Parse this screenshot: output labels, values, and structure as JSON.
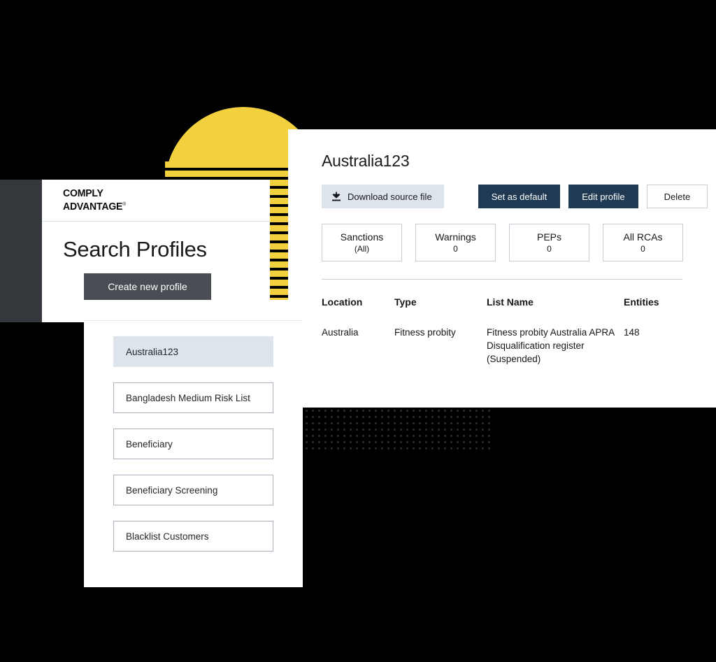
{
  "brand": {
    "name_line1": "COMPLY",
    "name_line2": "ADVANTAGE",
    "registered_mark": "®"
  },
  "search_panel": {
    "page_title": "Search Profiles",
    "create_button": "Create new profile",
    "profiles": [
      {
        "label": "Australia123",
        "selected": true
      },
      {
        "label": "Bangladesh Medium Risk List",
        "selected": false
      },
      {
        "label": "Beneficiary",
        "selected": false
      },
      {
        "label": "Beneficiary Screening",
        "selected": false
      },
      {
        "label": "Blacklist Customers",
        "selected": false
      }
    ]
  },
  "detail_panel": {
    "title": "Australia123",
    "actions": {
      "download": "Download source file",
      "set_default": "Set as default",
      "edit_profile": "Edit profile",
      "delete": "Delete"
    },
    "stats": [
      {
        "label": "Sanctions",
        "value": "(All)"
      },
      {
        "label": "Warnings",
        "value": "0"
      },
      {
        "label": "PEPs",
        "value": "0"
      },
      {
        "label": "All RCAs",
        "value": "0"
      }
    ],
    "table": {
      "headers": {
        "location": "Location",
        "type": "Type",
        "list_name": "List Name",
        "entities": "Entities"
      },
      "rows": [
        {
          "location": "Australia",
          "type": "Fitness probity",
          "list_name": "Fitness probity Australia APRA Disqualification register (Suspended)",
          "entities": "148"
        }
      ]
    }
  },
  "colors": {
    "brand_yellow": "#F3D03E",
    "navy": "#203A54",
    "dark_slate": "#4A4E54",
    "selected_bg": "#DEE4EC",
    "background": "#000000"
  }
}
